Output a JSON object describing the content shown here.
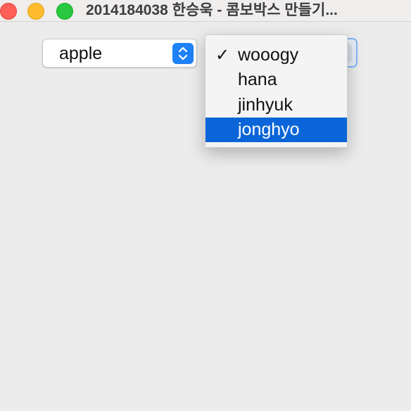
{
  "window": {
    "title": "2014184038 한승욱 - 콤보박스 만들기..."
  },
  "combo_box_1": {
    "selected_value": "apple",
    "stepper_icon": "up-down-chevron-icon",
    "accent_color": "#1e82f7"
  },
  "combo_box_2": {
    "stepper_icon": "up-down-chevron-icon",
    "focused": true,
    "open": true,
    "checked_item": "wooogy",
    "highlighted_item": "jonghyo",
    "items": [
      {
        "label": "wooogy",
        "checked": true
      },
      {
        "label": "hana",
        "checked": false
      },
      {
        "label": "jinhyuk",
        "checked": false
      },
      {
        "label": "jonghyo",
        "checked": false
      }
    ],
    "check_mark": "✓",
    "highlight_color": "#0b65d8"
  }
}
